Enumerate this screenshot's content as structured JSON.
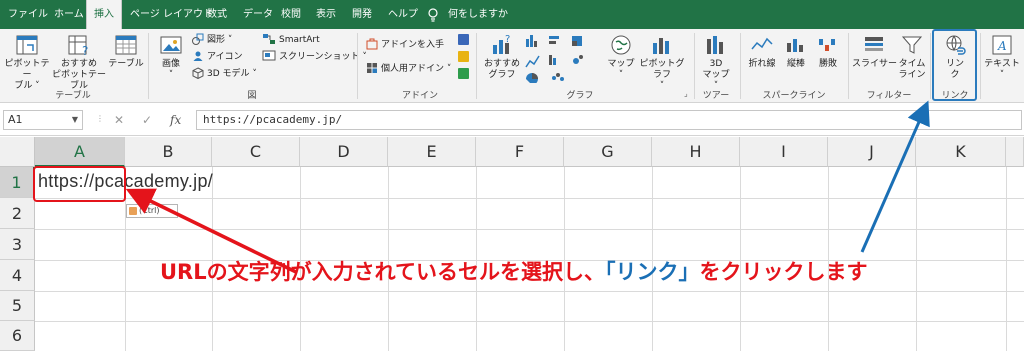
{
  "tabs": [
    "ファイル",
    "ホーム",
    "挿入",
    "ページ レイアウト",
    "数式",
    "データ",
    "校閲",
    "表示",
    "開発",
    "ヘルプ",
    "何をしますか"
  ],
  "active_tab": "挿入",
  "ribbon": {
    "groups": {
      "table": "テーブル",
      "figure": "図",
      "addin": "アドイン",
      "graph": "グラフ",
      "tour": "ツアー",
      "sparkline": "スパークライン",
      "filter": "フィルター",
      "link": "リンク"
    },
    "buttons": {
      "pivot_table": "ピボットテー\nブル ˅",
      "recommended_pivot": "おすすめ\nピボットテーブル",
      "table": "テーブル",
      "image": "画像\n˅",
      "shapes": "図形 ˅",
      "icons": "アイコン",
      "model3d": "3D モデル ˅",
      "smartart": "SmartArt",
      "screenshot": "スクリーンショット ˅",
      "get_addin": "アドインを入手",
      "my_addin": "個人用アドイン ˅",
      "recommended_chart": "おすすめ\nグラフ",
      "map": "マップ\n˅",
      "pivot_chart": "ピボットグラフ\n˅",
      "map3d": "3D\nマップ ˅",
      "line": "折れ線",
      "column": "縦棒",
      "winloss": "勝敗",
      "slicer": "スライサー",
      "timeline": "タイム\nライン",
      "link": "リン\nク",
      "text": "テキスト\n˅"
    }
  },
  "formula_bar": {
    "name_box": "A1",
    "fx": "fx",
    "content": "https://pcacademy.jp/"
  },
  "columns": [
    "A",
    "B",
    "C",
    "D",
    "E",
    "F",
    "G",
    "H",
    "I",
    "J",
    "K"
  ],
  "rows": [
    "1",
    "2",
    "3",
    "4",
    "5",
    "6"
  ],
  "cells": {
    "A1": "https://pcacademy.jp/"
  },
  "paste_options": "(Ctrl) ˅",
  "annotation": {
    "part1": "URLの文字列が入力されているセルを選択し、",
    "part2": "「リンク」",
    "part3": "をクリックします"
  },
  "colors": {
    "excel_green": "#217346",
    "callout_red": "#e4141b",
    "callout_blue": "#1a6fb5"
  }
}
